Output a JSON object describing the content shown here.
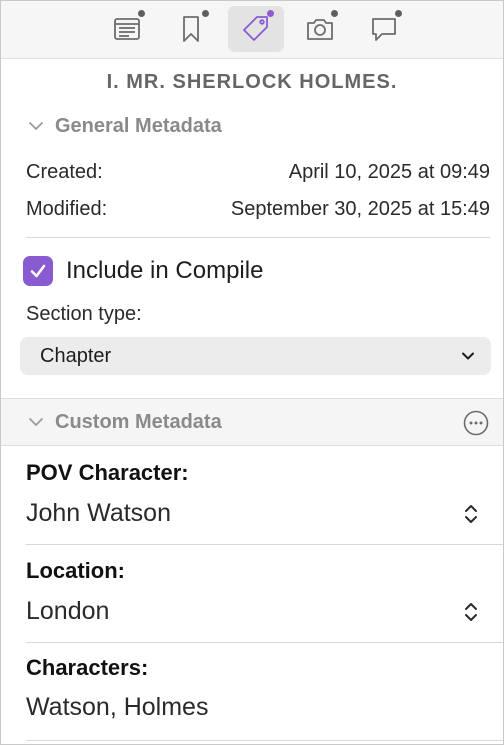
{
  "toolbar": {
    "buttons": [
      {
        "icon": "synopsis-icon",
        "active": false,
        "has_dot": true
      },
      {
        "icon": "bookmark-icon",
        "active": false,
        "has_dot": true
      },
      {
        "icon": "tag-icon",
        "active": true,
        "has_dot": true
      },
      {
        "icon": "camera-icon",
        "active": false,
        "has_dot": true
      },
      {
        "icon": "comment-icon",
        "active": false,
        "has_dot": true
      }
    ]
  },
  "document_title": "I. MR. SHERLOCK HOLMES.",
  "general": {
    "header": "General Metadata",
    "created_label": "Created:",
    "created_value": "April 10, 2025 at 09:49",
    "modified_label": "Modified:",
    "modified_value": "September 30, 2025 at 15:49",
    "include_label": "Include in Compile",
    "include_checked": true,
    "section_type_label": "Section type:",
    "section_type_value": "Chapter"
  },
  "custom": {
    "header": "Custom Metadata",
    "fields": [
      {
        "label": "POV Character:",
        "value": "John Watson",
        "type": "popup"
      },
      {
        "label": "Location:",
        "value": "London",
        "type": "popup"
      },
      {
        "label": "Characters:",
        "value": "Watson, Holmes",
        "type": "text"
      }
    ]
  },
  "colors": {
    "accent": "#8a5bd0",
    "toolbar_bg": "#f6f6f6",
    "section_header_text": "#8a8a8a"
  }
}
